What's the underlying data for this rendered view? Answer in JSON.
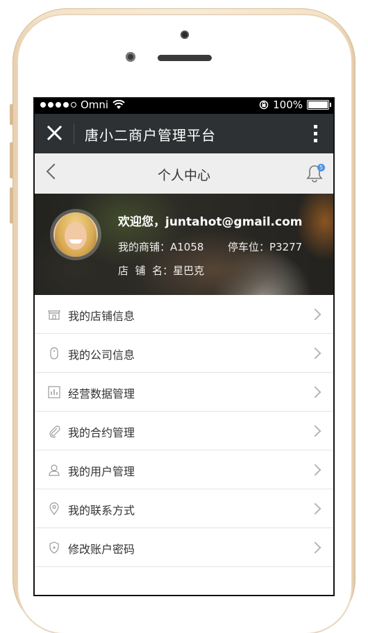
{
  "status_bar": {
    "carrier": "Omni",
    "battery": "100%",
    "battery_level": 1.0
  },
  "app": {
    "title": "唐小二商户管理平台"
  },
  "nav": {
    "title": "个人中心",
    "notification_count": "5"
  },
  "profile": {
    "welcome": "欢迎您，juntahot@gmail.com",
    "shop_no": "我的商铺：A1058",
    "parking": "停车位：P3277",
    "shop_name": "店  铺  名：星巴克"
  },
  "menu": {
    "items": [
      {
        "label": "我的店铺信息",
        "icon": "store-icon"
      },
      {
        "label": "我的公司信息",
        "icon": "mouse-icon"
      },
      {
        "label": "经营数据管理",
        "icon": "bar-chart-icon"
      },
      {
        "label": "我的合约管理",
        "icon": "paperclip-icon"
      },
      {
        "label": "我的用户管理",
        "icon": "user-icon"
      },
      {
        "label": "我的联系方式",
        "icon": "location-pin-icon"
      },
      {
        "label": "修改账户密码",
        "icon": "shield-icon"
      }
    ]
  },
  "colors": {
    "title_bar": "#2e3133",
    "nav_bar": "#eeeeee",
    "badge": "#4a90e2",
    "phone_frame": "#f3e2c8"
  }
}
